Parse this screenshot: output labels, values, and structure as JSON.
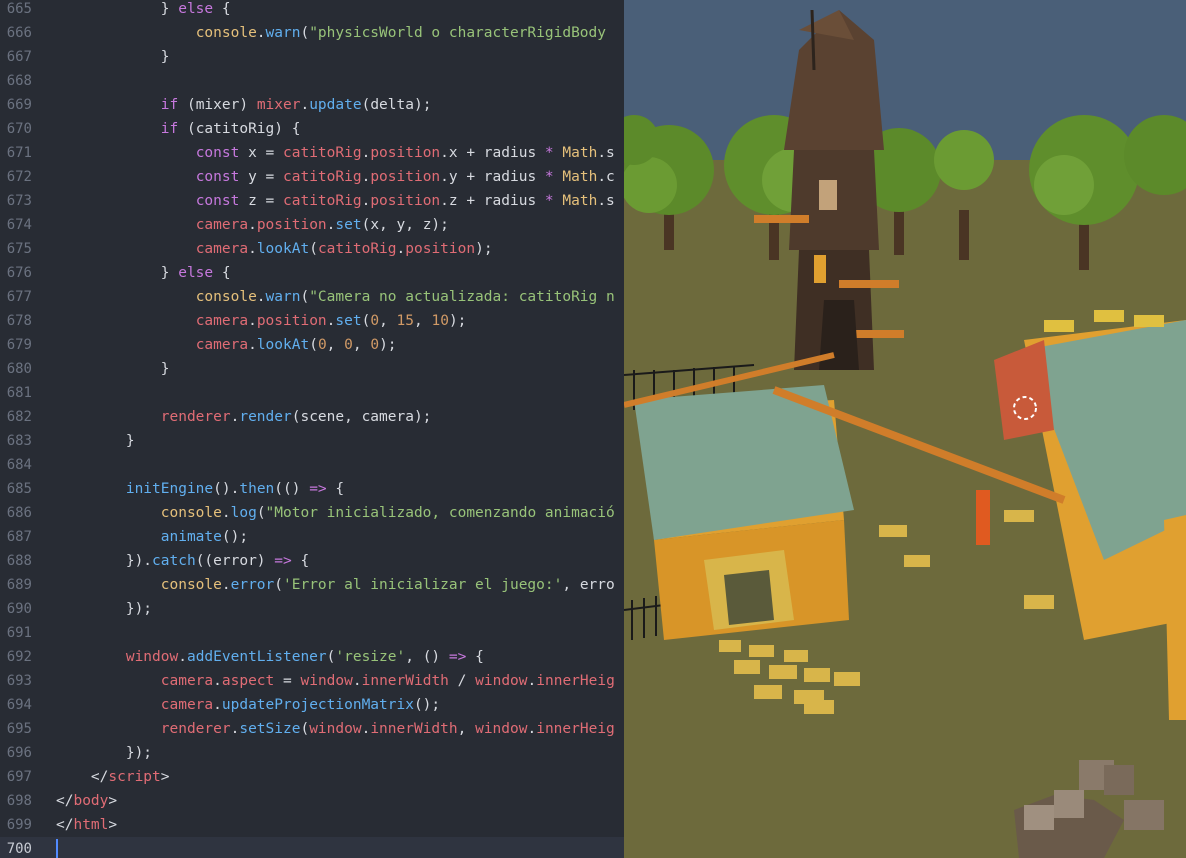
{
  "editor": {
    "lines": [
      {
        "n": "665",
        "tokens": [
          [
            "pl",
            "            } "
          ],
          [
            "kw",
            "else"
          ],
          [
            "pl",
            " {"
          ]
        ]
      },
      {
        "n": "666",
        "tokens": [
          [
            "pl",
            "                "
          ],
          [
            "obj",
            "console"
          ],
          [
            "pl",
            "."
          ],
          [
            "fn",
            "warn"
          ],
          [
            "pl",
            "("
          ],
          [
            "str",
            "\"physicsWorld o characterRigidBody"
          ]
        ]
      },
      {
        "n": "667",
        "tokens": [
          [
            "pl",
            "            }"
          ]
        ]
      },
      {
        "n": "668",
        "tokens": []
      },
      {
        "n": "669",
        "tokens": [
          [
            "pl",
            "            "
          ],
          [
            "kw",
            "if"
          ],
          [
            "pl",
            " (mixer) "
          ],
          [
            "var",
            "mixer"
          ],
          [
            "pl",
            "."
          ],
          [
            "fn",
            "update"
          ],
          [
            "pl",
            "(delta);"
          ]
        ]
      },
      {
        "n": "670",
        "tokens": [
          [
            "pl",
            "            "
          ],
          [
            "kw",
            "if"
          ],
          [
            "pl",
            " (catitoRig) {"
          ]
        ]
      },
      {
        "n": "671",
        "tokens": [
          [
            "pl",
            "                "
          ],
          [
            "kw",
            "const"
          ],
          [
            "pl",
            " x = "
          ],
          [
            "var",
            "catitoRig"
          ],
          [
            "pl",
            "."
          ],
          [
            "var",
            "position"
          ],
          [
            "pl",
            ".x + radius "
          ],
          [
            "kw",
            "*"
          ],
          [
            "pl",
            " "
          ],
          [
            "obj",
            "Math"
          ],
          [
            "pl",
            ".s"
          ]
        ]
      },
      {
        "n": "672",
        "tokens": [
          [
            "pl",
            "                "
          ],
          [
            "kw",
            "const"
          ],
          [
            "pl",
            " y = "
          ],
          [
            "var",
            "catitoRig"
          ],
          [
            "pl",
            "."
          ],
          [
            "var",
            "position"
          ],
          [
            "pl",
            ".y + radius "
          ],
          [
            "kw",
            "*"
          ],
          [
            "pl",
            " "
          ],
          [
            "obj",
            "Math"
          ],
          [
            "pl",
            ".c"
          ]
        ]
      },
      {
        "n": "673",
        "tokens": [
          [
            "pl",
            "                "
          ],
          [
            "kw",
            "const"
          ],
          [
            "pl",
            " z = "
          ],
          [
            "var",
            "catitoRig"
          ],
          [
            "pl",
            "."
          ],
          [
            "var",
            "position"
          ],
          [
            "pl",
            ".z + radius "
          ],
          [
            "kw",
            "*"
          ],
          [
            "pl",
            " "
          ],
          [
            "obj",
            "Math"
          ],
          [
            "pl",
            ".s"
          ]
        ]
      },
      {
        "n": "674",
        "tokens": [
          [
            "pl",
            "                "
          ],
          [
            "var",
            "camera"
          ],
          [
            "pl",
            "."
          ],
          [
            "var",
            "position"
          ],
          [
            "pl",
            "."
          ],
          [
            "fn",
            "set"
          ],
          [
            "pl",
            "(x, y, z);"
          ]
        ]
      },
      {
        "n": "675",
        "tokens": [
          [
            "pl",
            "                "
          ],
          [
            "var",
            "camera"
          ],
          [
            "pl",
            "."
          ],
          [
            "fn",
            "lookAt"
          ],
          [
            "pl",
            "("
          ],
          [
            "var",
            "catitoRig"
          ],
          [
            "pl",
            "."
          ],
          [
            "var",
            "position"
          ],
          [
            "pl",
            ");"
          ]
        ]
      },
      {
        "n": "676",
        "tokens": [
          [
            "pl",
            "            } "
          ],
          [
            "kw",
            "else"
          ],
          [
            "pl",
            " {"
          ]
        ]
      },
      {
        "n": "677",
        "tokens": [
          [
            "pl",
            "                "
          ],
          [
            "obj",
            "console"
          ],
          [
            "pl",
            "."
          ],
          [
            "fn",
            "warn"
          ],
          [
            "pl",
            "("
          ],
          [
            "str",
            "\"Camera no actualizada: catitoRig n"
          ]
        ]
      },
      {
        "n": "678",
        "tokens": [
          [
            "pl",
            "                "
          ],
          [
            "var",
            "camera"
          ],
          [
            "pl",
            "."
          ],
          [
            "var",
            "position"
          ],
          [
            "pl",
            "."
          ],
          [
            "fn",
            "set"
          ],
          [
            "pl",
            "("
          ],
          [
            "num",
            "0"
          ],
          [
            "pl",
            ", "
          ],
          [
            "num",
            "15"
          ],
          [
            "pl",
            ", "
          ],
          [
            "num",
            "10"
          ],
          [
            "pl",
            ");"
          ]
        ]
      },
      {
        "n": "679",
        "tokens": [
          [
            "pl",
            "                "
          ],
          [
            "var",
            "camera"
          ],
          [
            "pl",
            "."
          ],
          [
            "fn",
            "lookAt"
          ],
          [
            "pl",
            "("
          ],
          [
            "num",
            "0"
          ],
          [
            "pl",
            ", "
          ],
          [
            "num",
            "0"
          ],
          [
            "pl",
            ", "
          ],
          [
            "num",
            "0"
          ],
          [
            "pl",
            ");"
          ]
        ]
      },
      {
        "n": "680",
        "tokens": [
          [
            "pl",
            "            }"
          ]
        ]
      },
      {
        "n": "681",
        "tokens": []
      },
      {
        "n": "682",
        "tokens": [
          [
            "pl",
            "            "
          ],
          [
            "var",
            "renderer"
          ],
          [
            "pl",
            "."
          ],
          [
            "fn",
            "render"
          ],
          [
            "pl",
            "(scene, camera);"
          ]
        ]
      },
      {
        "n": "683",
        "tokens": [
          [
            "pl",
            "        }"
          ]
        ]
      },
      {
        "n": "684",
        "tokens": []
      },
      {
        "n": "685",
        "tokens": [
          [
            "pl",
            "        "
          ],
          [
            "fn",
            "initEngine"
          ],
          [
            "pl",
            "()."
          ],
          [
            "fn",
            "then"
          ],
          [
            "pl",
            "(() "
          ],
          [
            "kw",
            "=>"
          ],
          [
            "pl",
            " {"
          ]
        ]
      },
      {
        "n": "686",
        "tokens": [
          [
            "pl",
            "            "
          ],
          [
            "obj",
            "console"
          ],
          [
            "pl",
            "."
          ],
          [
            "fn",
            "log"
          ],
          [
            "pl",
            "("
          ],
          [
            "str",
            "\"Motor inicializado, comenzando animació"
          ]
        ]
      },
      {
        "n": "687",
        "tokens": [
          [
            "pl",
            "            "
          ],
          [
            "fn",
            "animate"
          ],
          [
            "pl",
            "();"
          ]
        ]
      },
      {
        "n": "688",
        "tokens": [
          [
            "pl",
            "        })."
          ],
          [
            "fn",
            "catch"
          ],
          [
            "pl",
            "((error) "
          ],
          [
            "kw",
            "=>"
          ],
          [
            "pl",
            " {"
          ]
        ]
      },
      {
        "n": "689",
        "tokens": [
          [
            "pl",
            "            "
          ],
          [
            "obj",
            "console"
          ],
          [
            "pl",
            "."
          ],
          [
            "fn",
            "error"
          ],
          [
            "pl",
            "("
          ],
          [
            "str",
            "'Error al inicializar el juego:'"
          ],
          [
            "pl",
            ", erro"
          ]
        ]
      },
      {
        "n": "690",
        "tokens": [
          [
            "pl",
            "        });"
          ]
        ]
      },
      {
        "n": "691",
        "tokens": []
      },
      {
        "n": "692",
        "tokens": [
          [
            "pl",
            "        "
          ],
          [
            "var",
            "window"
          ],
          [
            "pl",
            "."
          ],
          [
            "fn",
            "addEventListener"
          ],
          [
            "pl",
            "("
          ],
          [
            "str",
            "'resize'"
          ],
          [
            "pl",
            ", () "
          ],
          [
            "kw",
            "=>"
          ],
          [
            "pl",
            " {"
          ]
        ]
      },
      {
        "n": "693",
        "tokens": [
          [
            "pl",
            "            "
          ],
          [
            "var",
            "camera"
          ],
          [
            "pl",
            "."
          ],
          [
            "var",
            "aspect"
          ],
          [
            "pl",
            " = "
          ],
          [
            "var",
            "window"
          ],
          [
            "pl",
            "."
          ],
          [
            "var",
            "innerWidth"
          ],
          [
            "pl",
            " / "
          ],
          [
            "var",
            "window"
          ],
          [
            "pl",
            "."
          ],
          [
            "var",
            "innerHeig"
          ]
        ]
      },
      {
        "n": "694",
        "tokens": [
          [
            "pl",
            "            "
          ],
          [
            "var",
            "camera"
          ],
          [
            "pl",
            "."
          ],
          [
            "fn",
            "updateProjectionMatrix"
          ],
          [
            "pl",
            "();"
          ]
        ]
      },
      {
        "n": "695",
        "tokens": [
          [
            "pl",
            "            "
          ],
          [
            "var",
            "renderer"
          ],
          [
            "pl",
            "."
          ],
          [
            "fn",
            "setSize"
          ],
          [
            "pl",
            "("
          ],
          [
            "var",
            "window"
          ],
          [
            "pl",
            "."
          ],
          [
            "var",
            "innerWidth"
          ],
          [
            "pl",
            ", "
          ],
          [
            "var",
            "window"
          ],
          [
            "pl",
            "."
          ],
          [
            "var",
            "innerHeig"
          ]
        ]
      },
      {
        "n": "696",
        "tokens": [
          [
            "pl",
            "        });"
          ]
        ]
      },
      {
        "n": "697",
        "tokens": [
          [
            "pl",
            "    </"
          ],
          [
            "var",
            "script"
          ],
          [
            "pl",
            ">"
          ]
        ]
      },
      {
        "n": "698",
        "tokens": [
          [
            "pl",
            "</"
          ],
          [
            "var",
            "body"
          ],
          [
            "pl",
            ">"
          ]
        ]
      },
      {
        "n": "699",
        "tokens": [
          [
            "pl",
            "</"
          ],
          [
            "var",
            "html"
          ],
          [
            "pl",
            ">"
          ]
        ]
      },
      {
        "n": "700",
        "tokens": [],
        "current": true
      }
    ]
  },
  "viewport": {
    "scene": "3d-village-render",
    "colors": {
      "sky": "#4a5f78",
      "ground": "#6d6a3c",
      "roof": "#7fa390",
      "wall": "#e0a030",
      "tower": "#4e3a2c",
      "trees": "#5c8a2a"
    }
  },
  "theme": {
    "background": "#282c34",
    "keyword": "#c678dd",
    "variable": "#e06c75",
    "function": "#61afef",
    "string": "#98c379",
    "number": "#d19a66",
    "object": "#e5c07b"
  }
}
